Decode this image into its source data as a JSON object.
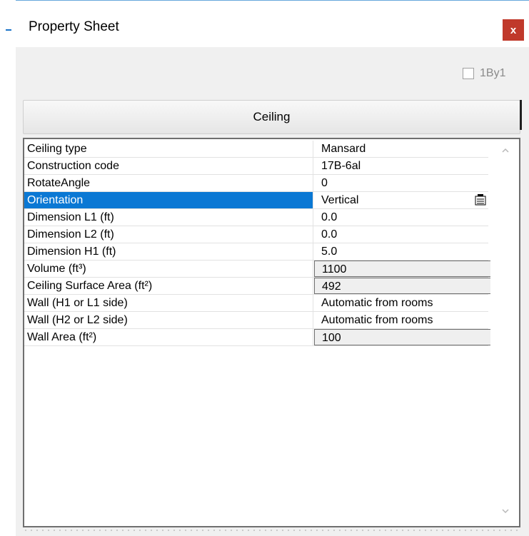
{
  "window": {
    "title": "Property Sheet",
    "close_label": "x"
  },
  "options": {
    "checkbox_label": "1By1",
    "checked": false
  },
  "tabs": [
    {
      "label": "Ceiling"
    }
  ],
  "properties": [
    {
      "name": "Ceiling type",
      "value": "Mansard"
    },
    {
      "name": "Construction code",
      "value": "17B-6al"
    },
    {
      "name": "RotateAngle",
      "value": "0"
    },
    {
      "name": "Orientation",
      "value": "Vertical"
    },
    {
      "name": "Dimension L1 (ft)",
      "value": "0.0"
    },
    {
      "name": "Dimension L2 (ft)",
      "value": "0.0"
    },
    {
      "name": "Dimension H1 (ft)",
      "value": "5.0"
    },
    {
      "name": "Volume (ft³)",
      "value": "1100"
    },
    {
      "name": "Ceiling Surface Area (ft²)",
      "value": "492"
    },
    {
      "name": "Wall (H1 or L1 side)",
      "value": "Automatic from rooms"
    },
    {
      "name": "Wall (H2 or L2 side)",
      "value": "Automatic from rooms"
    },
    {
      "name": "Wall Area (ft²)",
      "value": "100"
    }
  ],
  "icons": {
    "close": "close-icon",
    "edit": "ellipsis-editor-icon",
    "scroll_up": "chevron-up-icon",
    "scroll_down": "chevron-down-icon"
  },
  "colors": {
    "selection": "#0a78d4",
    "close_button": "#c0392b",
    "readonly_fill": "#efefef"
  }
}
